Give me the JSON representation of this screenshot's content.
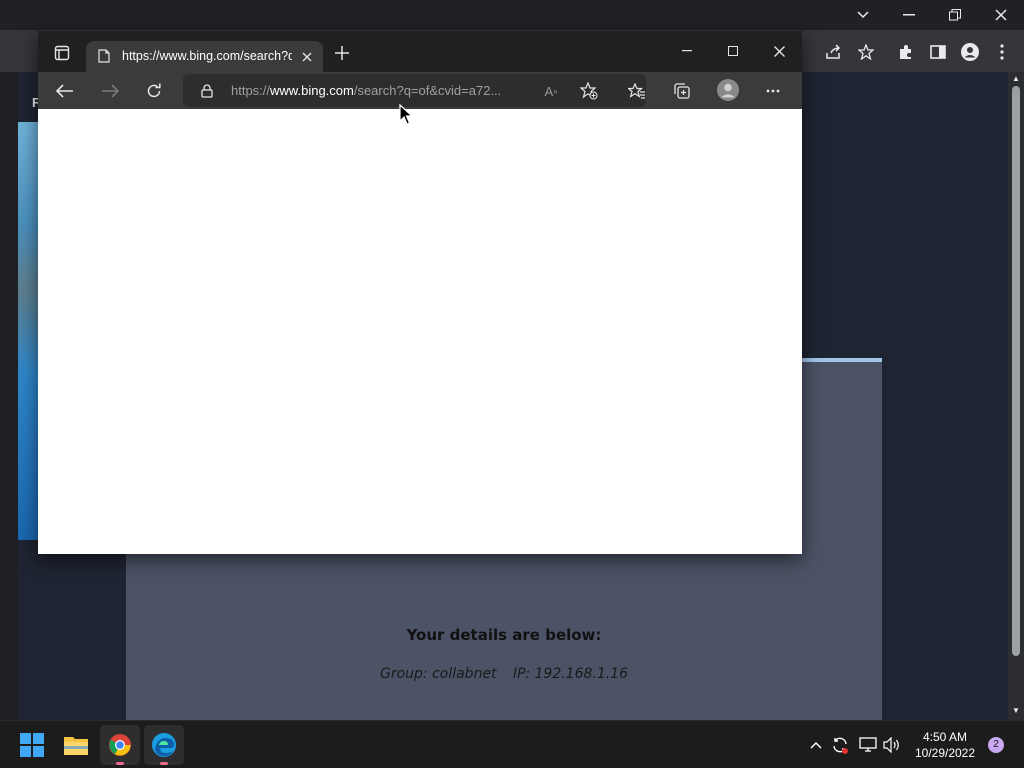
{
  "background_window": {
    "partial_label": "F",
    "card_red_text": "",
    "details_title": "Your details are below:",
    "details_group_label": "Group: collabnet",
    "details_ip_label": "IP: 192.168.1.16"
  },
  "edge": {
    "tab_title": "https://www.bing.com/search?q=",
    "url_prefix": "https://",
    "url_domain": "www.bing.com",
    "url_rest": "/search?q=of&cvid=a72..."
  },
  "taskbar": {
    "time": "4:50 AM",
    "date": "10/29/2022",
    "notification_count": "2"
  },
  "colors": {
    "edge_frame": "#202020",
    "edge_toolbar": "#3b3b3b",
    "chrome_bg": "#202124",
    "card_bg": "#4c5366",
    "taskbar_bg": "#1c1c1c"
  }
}
